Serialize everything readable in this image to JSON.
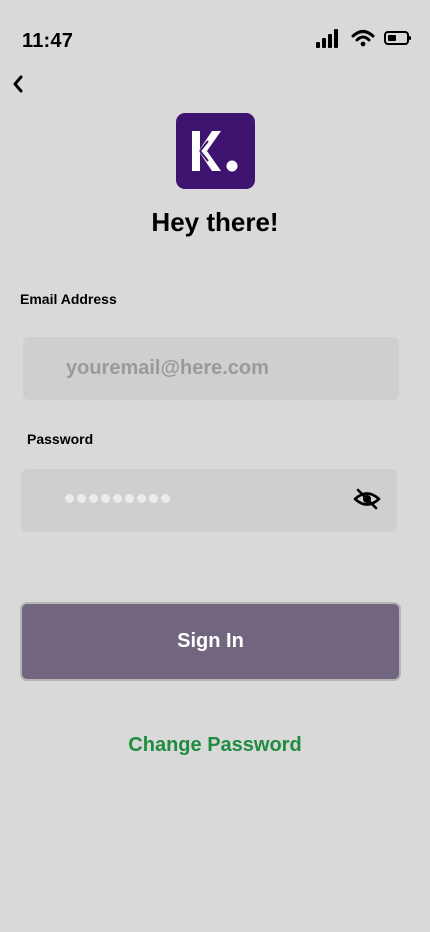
{
  "status_bar": {
    "time": "11:47",
    "signal_icon": "cellular-signal-icon",
    "wifi_icon": "wifi-icon",
    "battery_icon": "battery-low-icon"
  },
  "nav": {
    "back_icon": "chevron-left-icon"
  },
  "logo": {
    "letter": "K",
    "background_color": "#3f1470"
  },
  "greeting": "Hey there!",
  "form": {
    "email": {
      "label": "Email Address",
      "value": "",
      "placeholder": "youremail@here.com"
    },
    "password": {
      "label": "Password",
      "masked_length": 9,
      "toggle_icon": "eye-off-icon"
    },
    "submit_label": "Sign In",
    "change_password_label": "Change Password"
  },
  "colors": {
    "background": "#d9d9d9",
    "field_background": "#cfcfcf",
    "button_background": "#72657f",
    "link_color": "#1f8c3f"
  }
}
